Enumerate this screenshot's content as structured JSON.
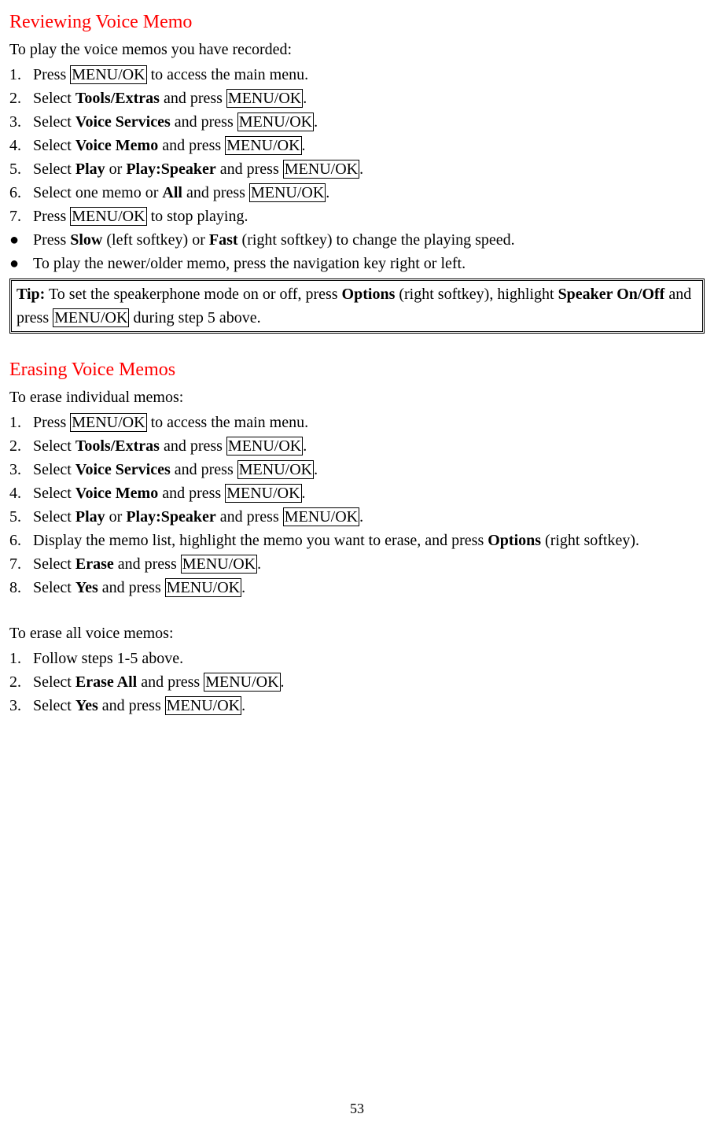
{
  "key": {
    "menuok": "MENU/OK"
  },
  "section1": {
    "heading": "Reviewing Voice Memo",
    "intro": "To play the voice memos you have recorded:",
    "steps": {
      "s1_a": "Press ",
      "s1_b": " to access the main menu.",
      "s2_a": "Select ",
      "s2_b": "Tools/Extras",
      "s2_c": " and press ",
      "s2_d": ".",
      "s3_a": "Select ",
      "s3_b": "Voice Services",
      "s3_c": " and press ",
      "s3_d": ".",
      "s4_a": "Select ",
      "s4_b": "Voice Memo",
      "s4_c": " and press ",
      "s4_d": ".",
      "s5_a": "Select ",
      "s5_b": "Play",
      "s5_c": " or ",
      "s5_d": "Play:Speaker",
      "s5_e": " and press ",
      "s5_f": ".",
      "s6_a": "Select one memo or ",
      "s6_b": "All",
      "s6_c": " and press ",
      "s6_d": ".",
      "s7_a": "Press ",
      "s7_b": " to stop playing."
    },
    "bullets": {
      "b1_a": "Press ",
      "b1_b": "Slow",
      "b1_c": " (left softkey) or ",
      "b1_d": "Fast",
      "b1_e": " (right softkey) to change the playing speed.",
      "b2": "To play the newer/older memo, press the navigation key right or left."
    },
    "tip": {
      "a": "Tip:",
      "b": " To set the speakerphone mode on or off, press ",
      "c": "Options",
      "d": " (right softkey), highlight ",
      "e": "Speaker On/Off",
      "f": " and press ",
      "g": " during step 5 above."
    }
  },
  "section2": {
    "heading": "Erasing Voice Memos",
    "intro": "To erase individual memos:",
    "steps": {
      "s1_a": "Press ",
      "s1_b": " to access the main menu.",
      "s2_a": "Select ",
      "s2_b": "Tools/Extras",
      "s2_c": " and press ",
      "s2_d": ".",
      "s3_a": "Select ",
      "s3_b": "Voice Services",
      "s3_c": " and press ",
      "s3_d": ".",
      "s4_a": "Select ",
      "s4_b": "Voice Memo",
      "s4_c": " and press ",
      "s4_d": ".",
      "s5_a": "Select ",
      "s5_b": "Play",
      "s5_c": " or ",
      "s5_d": "Play:Speaker",
      "s5_e": " and press ",
      "s5_f": ".",
      "s6_a": "Display the memo list, highlight the memo you want to erase, and press ",
      "s6_b": "Options",
      "s6_c": " (right softkey).",
      "s7_a": "Select ",
      "s7_b": "Erase",
      "s7_c": " and press ",
      "s7_d": ".",
      "s8_a": "Select ",
      "s8_b": "Yes",
      "s8_c": " and press ",
      "s8_d": "."
    }
  },
  "section3": {
    "intro": "To erase all voice memos:",
    "steps": {
      "s1": "Follow steps 1-5 above.",
      "s2_a": "Select ",
      "s2_b": "Erase All",
      "s2_c": " and press ",
      "s2_d": ".",
      "s3_a": "Select ",
      "s3_b": "Yes",
      "s3_c": " and press ",
      "s3_d": "."
    }
  },
  "pagenum": "53"
}
